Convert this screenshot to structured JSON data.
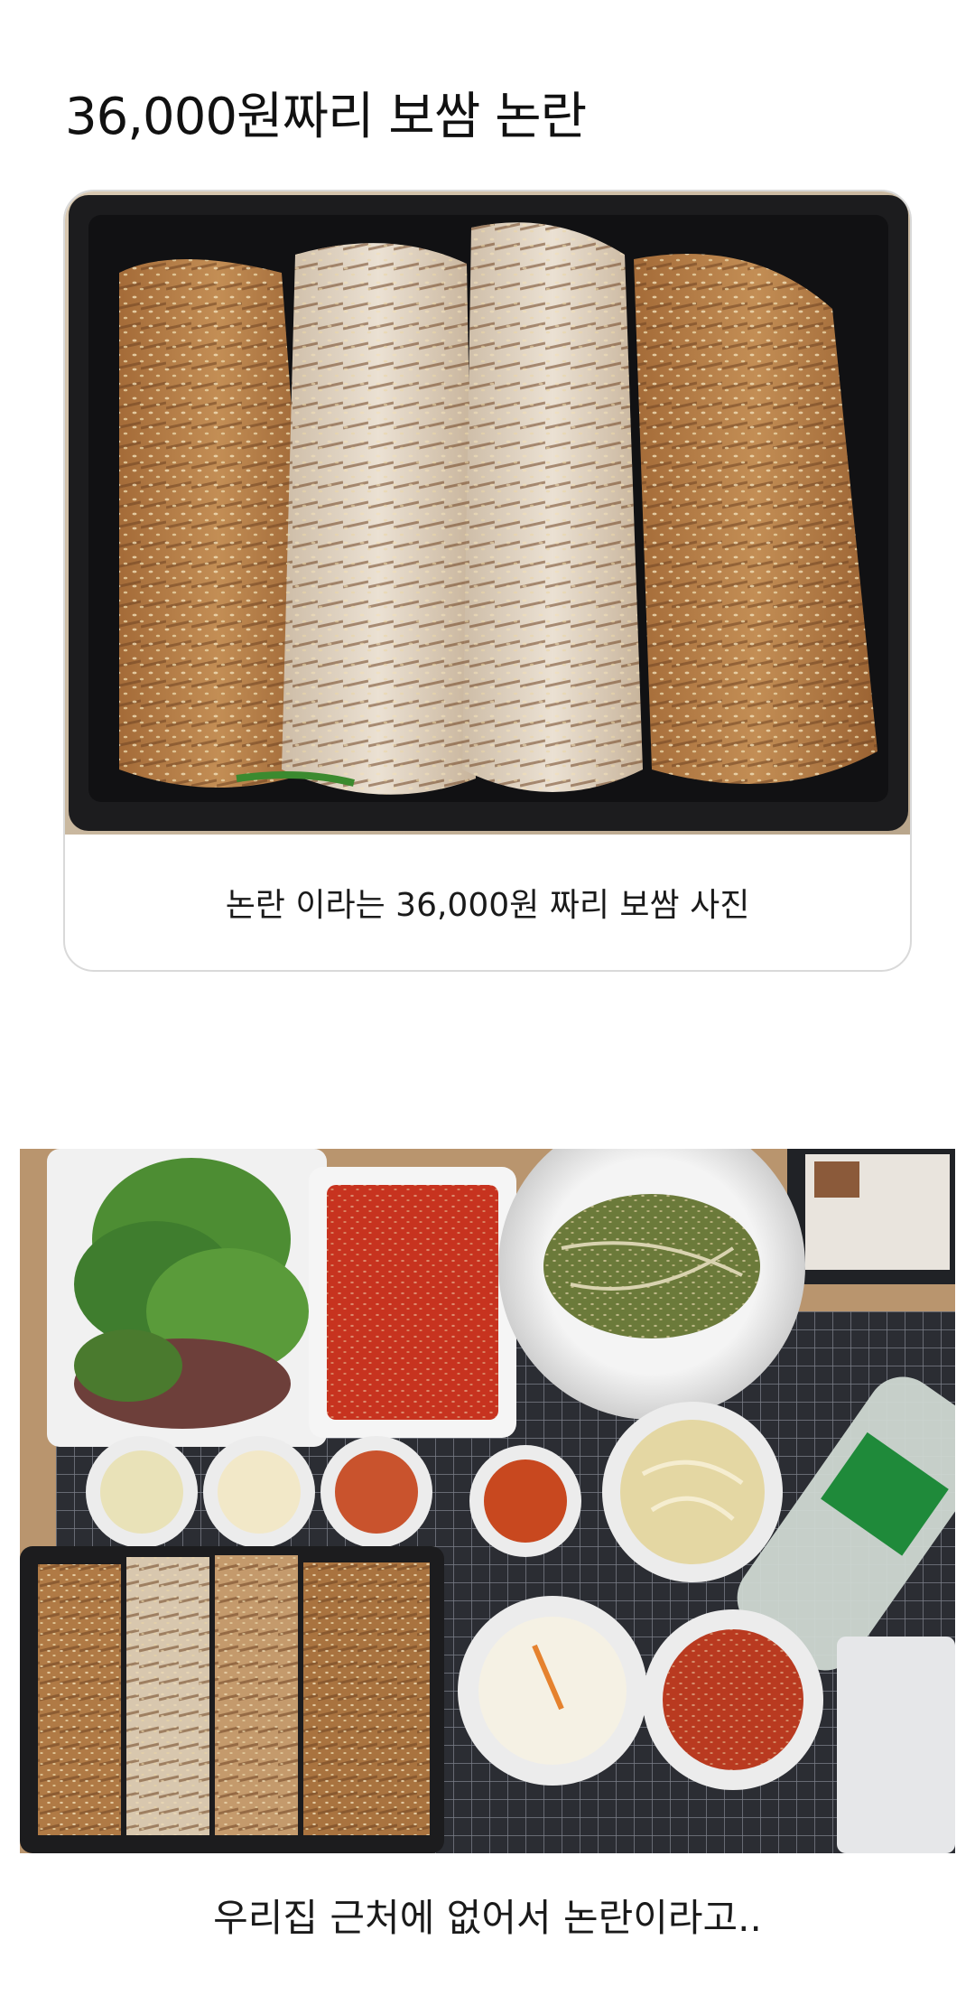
{
  "post": {
    "title": "36,000원짜리 보쌈 논란",
    "card": {
      "photo_subject": "pork-bossam-tray",
      "caption": "논란 이라는 36,000원 짜리 보쌈 사진"
    },
    "second_photo_subject": "bossam-delivery-spread",
    "bottom_caption": "우리집 근처에 없어서 논란이라고.."
  },
  "colors": {
    "tray": "#1c1c1e",
    "pork_skin": "#b07a45",
    "pork_meat": "#e6d9c8",
    "kimchi": "#c7331f",
    "lettuce": "#3f7d2e",
    "grid_mat": "#2b2d33",
    "bottle_label": "#1f8a3a"
  }
}
